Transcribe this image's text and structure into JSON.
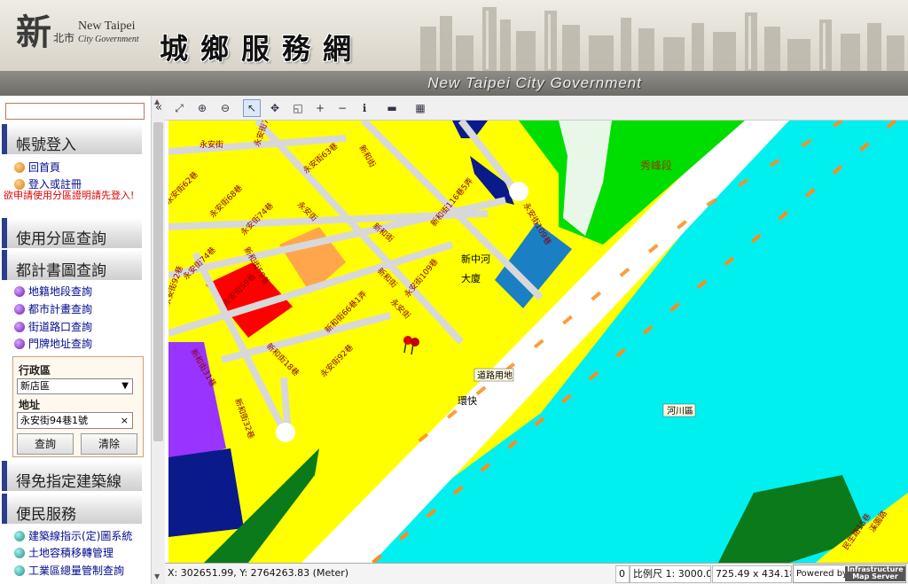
{
  "header": {
    "logo_char": "新",
    "logo_sub": "北市",
    "logo_en_1": "New Taipei",
    "logo_en_2": "City Government",
    "site_title": "城鄉服務網",
    "band_text": "New Taipei City Government"
  },
  "sidebar": {
    "search_value": "",
    "sections": {
      "account": "帳號登入",
      "zoning": "使用分區查詢",
      "plan": "都計書圖查詢",
      "exempt": "得免指定建築線",
      "service": "便民服務"
    },
    "account_links": [
      "回首頁",
      "登入或註冊"
    ],
    "notice": "欲申請使用分區證明請先登入!",
    "plan_links": [
      "地籍地段查詢",
      "都市計畫查詢",
      "街道路口查詢",
      "門牌地址查詢"
    ],
    "address_form": {
      "district_label": "行政區",
      "district_value": "新店區",
      "address_label": "地址",
      "address_value": "永安街94巷1號",
      "clear_x": "×",
      "query_button": "查詢",
      "clear_button": "清除"
    },
    "service_links": [
      "建築線指示(定)圖系統",
      "土地容積移轉管理",
      "工業區總量管制查詢"
    ]
  },
  "toolbar": {
    "collapse": "«",
    "tools": [
      {
        "name": "full-extent",
        "glyph": "⤢"
      },
      {
        "name": "zoom-in-tool",
        "glyph": "⊕"
      },
      {
        "name": "zoom-out-tool",
        "glyph": "⊖"
      },
      {
        "name": "pointer",
        "glyph": "↖"
      },
      {
        "name": "pan",
        "glyph": "✥"
      },
      {
        "name": "zoom-box",
        "glyph": "◱"
      },
      {
        "name": "zoom-in",
        "glyph": "+"
      },
      {
        "name": "zoom-out",
        "glyph": "−"
      },
      {
        "name": "identify",
        "glyph": "ℹ"
      },
      {
        "name": "measure",
        "glyph": "▬"
      },
      {
        "name": "print",
        "glyph": "▦"
      }
    ]
  },
  "map": {
    "street_labels": [
      "永安街",
      "永安街75巷",
      "永安街63巷",
      "新和街",
      "永安街62巷",
      "永安街68巷",
      "永安街74巷",
      "永安街",
      "新和街59巷",
      "新和街116巷5弄",
      "永安街109巷",
      "永安街74巷",
      "新和街",
      "永安街109巷",
      "新和街",
      "永安街59巷",
      "新和街66巷1弄",
      "永安街",
      "永安街92巷",
      "新和街18巷",
      "新和街31巷",
      "新和街32巷",
      "永安街92巷",
      "民生路15巷",
      "溪園路"
    ],
    "place_labels": {
      "peak": "秀峰段",
      "building_1": "新中河",
      "building_2": "大廈",
      "road_land": "道路用地",
      "expressway": "環快",
      "river": "河川區"
    }
  },
  "statusbar": {
    "coords": "X: 302651.99, Y: 2764263.83 (Meter)",
    "zero": "0",
    "scale": "比例尺 1: 3000.00",
    "size": "725.49 x 434.18 (",
    "powered": "Powered by",
    "ims_1": "Infrastructure",
    "ims_2": "Map Server"
  },
  "colors": {
    "residential": "#ffff00",
    "river": "#00f0f0",
    "road": "#ffffff",
    "park": "#00dd00",
    "commercial": "#ff0000",
    "orange_zone": "#ffa64d",
    "purple_zone": "#9933ff",
    "navy_zone": "#0a1a8a",
    "blue_zone": "#1b7fc4",
    "dark_green": "#0a7a1a",
    "dash_orange": "#ff8c1a"
  }
}
